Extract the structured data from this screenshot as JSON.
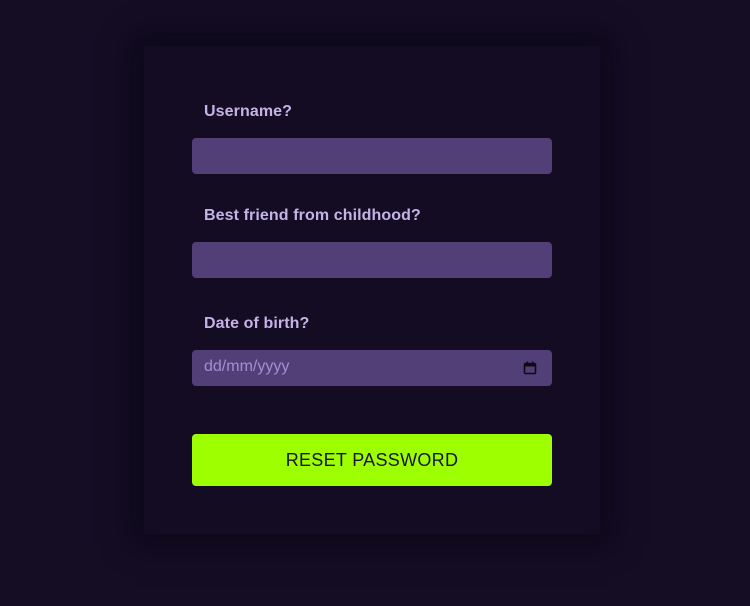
{
  "form": {
    "username": {
      "label": "Username?",
      "value": ""
    },
    "best_friend": {
      "label": "Best friend from childhood?",
      "value": ""
    },
    "date_of_birth": {
      "label": "Date of birth?",
      "placeholder": "dd/mm/yyyy",
      "icon": "calendar-icon"
    },
    "submit_label": "RESET PASSWORD"
  },
  "colors": {
    "background": "#140d24",
    "card": "#130c22",
    "input": "#533f77",
    "label": "#c5b3e6",
    "accent": "#9dff00"
  }
}
